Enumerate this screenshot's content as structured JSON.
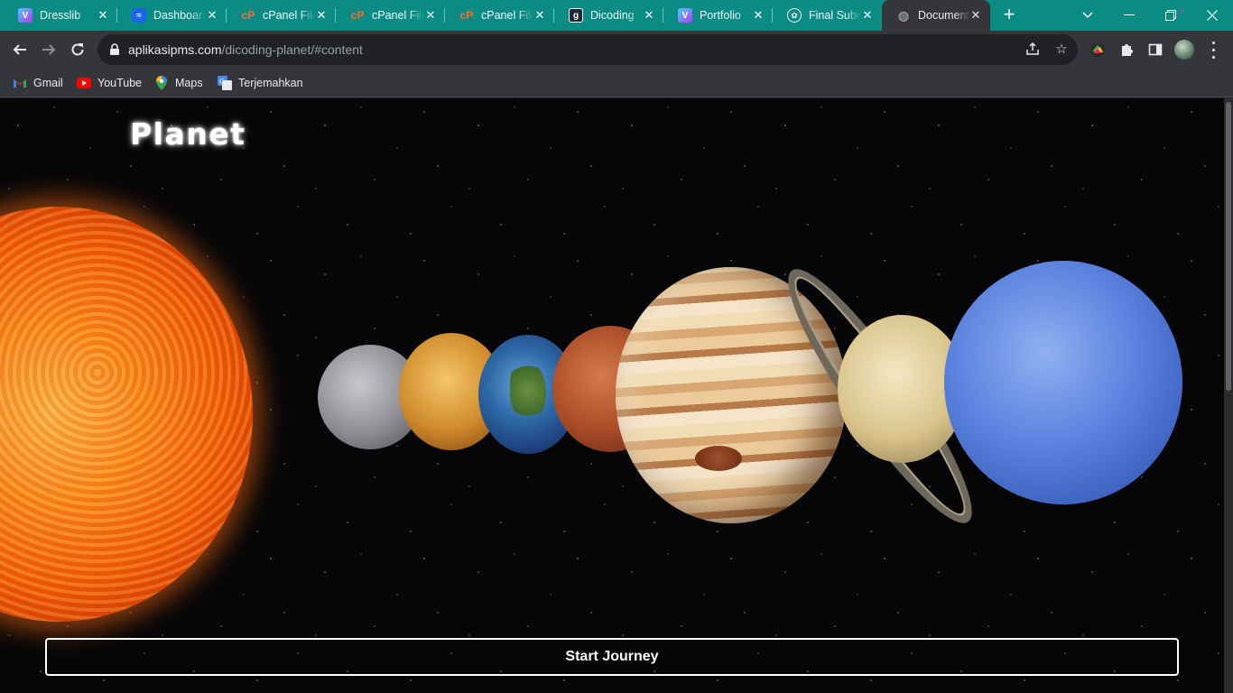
{
  "browser": {
    "tabs": [
      {
        "title": "Dresslib",
        "favicon": "vite-icon",
        "active": false
      },
      {
        "title": "Dashboard",
        "favicon": "dashboard-icon",
        "active": false
      },
      {
        "title": "cPanel File",
        "favicon": "cpanel-icon",
        "active": false
      },
      {
        "title": "cPanel File",
        "favicon": "cpanel-icon",
        "active": false
      },
      {
        "title": "cPanel File",
        "favicon": "cpanel-icon",
        "active": false
      },
      {
        "title": "Dicoding",
        "favicon": "dicoding-icon",
        "active": false
      },
      {
        "title": "Portfolio",
        "favicon": "vite-icon",
        "active": false
      },
      {
        "title": "Final Subm",
        "favicon": "openai-icon",
        "active": false
      },
      {
        "title": "Document",
        "favicon": "globe-icon",
        "active": true
      }
    ],
    "address": {
      "host": "aplikasipms.com",
      "path": "/dicoding-planet/#content"
    },
    "bookmarks": [
      {
        "label": "Gmail",
        "icon": "gmail-icon"
      },
      {
        "label": "YouTube",
        "icon": "youtube-icon"
      },
      {
        "label": "Maps",
        "icon": "maps-icon"
      },
      {
        "label": "Terjemahkan",
        "icon": "translate-icon"
      }
    ]
  },
  "page": {
    "title": "Planet",
    "start_button_label": "Start Journey",
    "bodies": [
      "sun",
      "mercury",
      "venus",
      "earth",
      "mars",
      "jupiter",
      "saturn",
      "neptune"
    ]
  },
  "colors": {
    "tabstrip": "#0a8c84",
    "toolbar": "#35363a",
    "page_background": "#060608"
  }
}
